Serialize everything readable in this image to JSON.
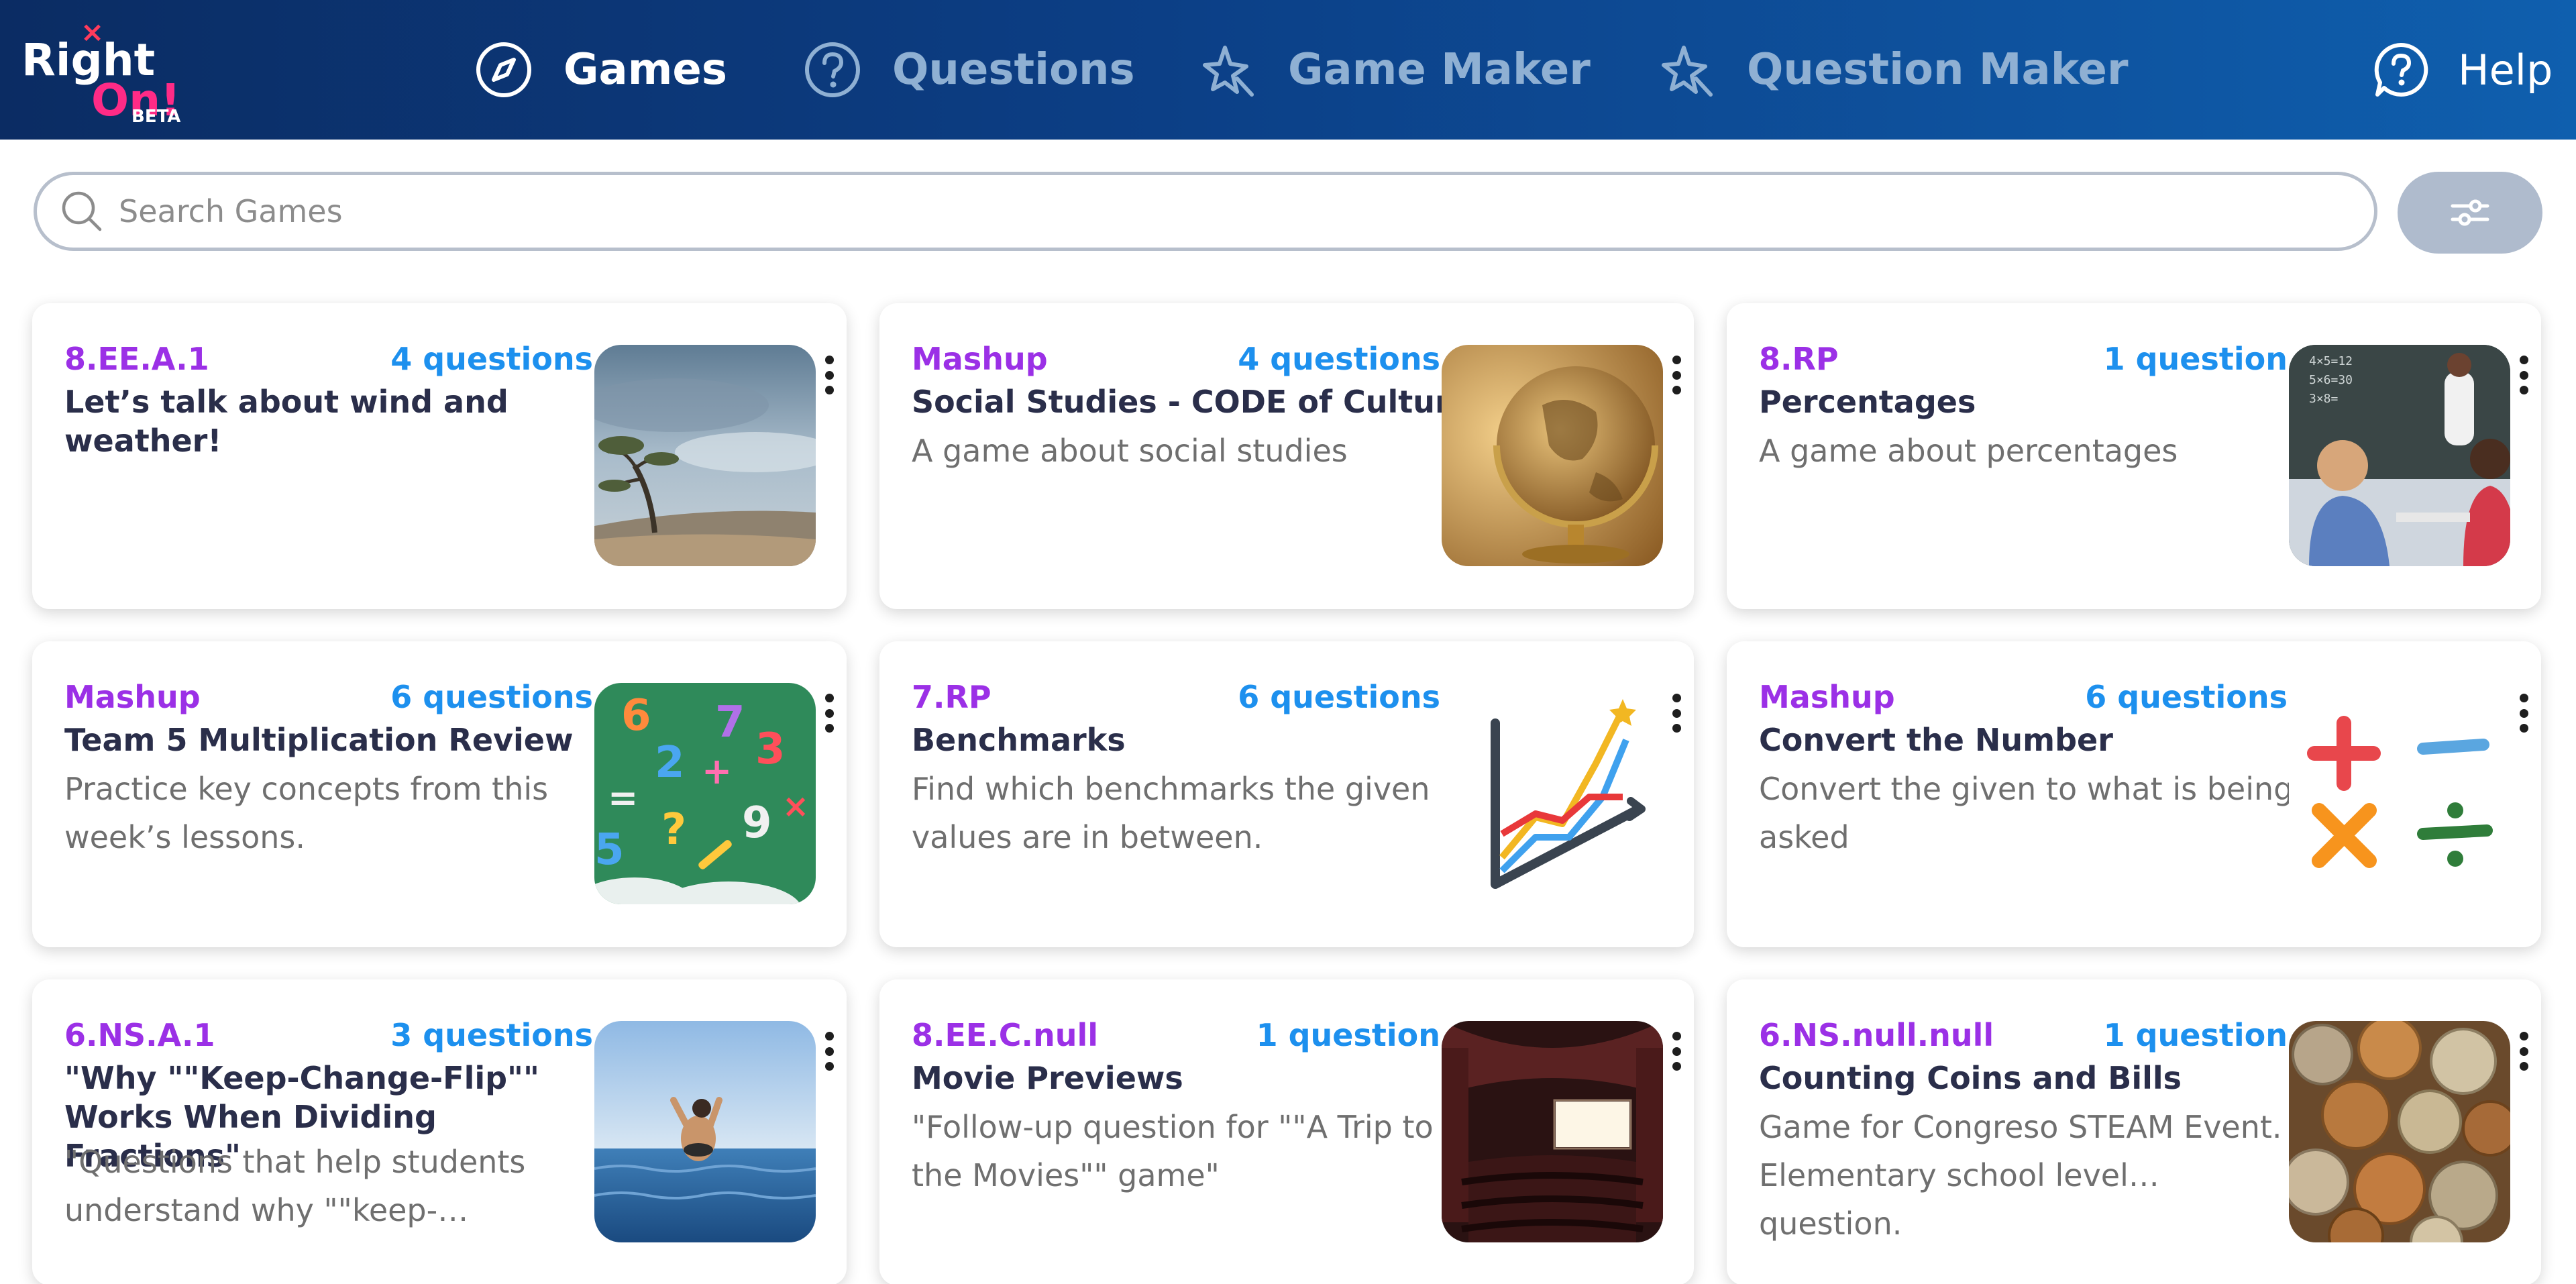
{
  "logo": {
    "text_right": "Right",
    "text_on": "On!",
    "badge": "BETA"
  },
  "nav": {
    "games": "Games",
    "questions": "Questions",
    "game_maker": "Game Maker",
    "question_maker": "Question Maker",
    "help": "Help"
  },
  "search": {
    "placeholder": "Search Games",
    "value": ""
  },
  "colors": {
    "header_start": "#0b2c63",
    "header_end": "#0f5fae",
    "code": "#9b30e6",
    "question_count": "#1d90ee",
    "title": "#2a2e4a"
  },
  "cards": [
    {
      "code": "8.EE.A.1",
      "questions": "4 questions",
      "title": "Let’s talk about wind and weather!",
      "description": "",
      "image": "windswept-tree"
    },
    {
      "code": "Mashup",
      "questions": "4 questions",
      "title": "Social Studies - CODE of Culture",
      "description": "A game about social studies",
      "image": "globe"
    },
    {
      "code": "8.RP",
      "questions": "1 question",
      "title": "Percentages",
      "description": "A game about percentages",
      "image": "classroom"
    },
    {
      "code": "Mashup",
      "questions": "6 questions",
      "title": "Team 5 Multiplication Review",
      "description": "Practice key concepts from this week’s lessons.",
      "image": "math-chalkboard"
    },
    {
      "code": "7.RP",
      "questions": "6 questions",
      "title": "Benchmarks",
      "description": "Find which benchmarks the given values are in between.",
      "image": "line-chart"
    },
    {
      "code": "Mashup",
      "questions": "6 questions",
      "title": "Convert the Number",
      "description": "Convert the given to what is being asked",
      "image": "math-operators"
    },
    {
      "code": "6.NS.A.1",
      "questions": "3 questions",
      "title": "\"Why \"\"Keep-Change-Flip\"\" Works When Dividing Fractions\"",
      "description": "\"Questions that help students understand why \"\"keep-…",
      "image": "ocean-jump"
    },
    {
      "code": "8.EE.C.null",
      "questions": "1 question",
      "title": "Movie Previews",
      "description": "\"Follow-up question for \"\"A Trip to the Movies\"\" game\"",
      "image": "movie-theater"
    },
    {
      "code": "6.NS.null.null",
      "questions": "1 question",
      "title": "Counting Coins and Bills",
      "description": "Game for Congreso STEAM Event. Elementary school level… question.",
      "image": "coins"
    }
  ]
}
